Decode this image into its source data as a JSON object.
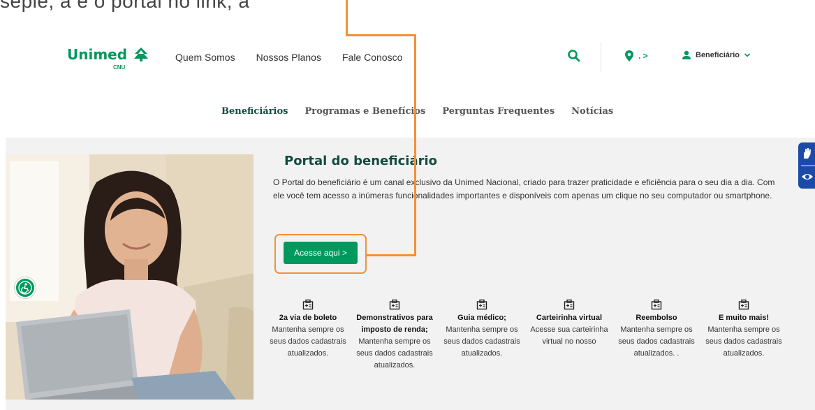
{
  "top_text": "sepie, a e                                            o portal no link, a",
  "logo": {
    "word": "Unimed",
    "sub": "CNU"
  },
  "nav": [
    "Quem Somos",
    "Nossos Planos",
    "Fale Conosco"
  ],
  "location": {
    "label": ". >"
  },
  "user_menu": {
    "label": "Beneficiário"
  },
  "subnav": [
    "Beneficiários",
    "Programas e Benefícios",
    "Perguntas Frequentes",
    "Notícias"
  ],
  "portal": {
    "title": "Portal do beneficiário",
    "description": "O Portal do beneficiário é um canal exclusivo da Unimed Nacional, criado para trazer praticidade e eficiência para o seu dia a dia. Com ele você tem acesso a inúmeras funcionalidades importantes e disponíveis com apenas um clique no seu computador ou smartphone.",
    "cta": "Acesse aqui >"
  },
  "features": [
    {
      "title": "2a via de boleto",
      "desc": "Mantenha sempre os seus dados cadastrais atualizados."
    },
    {
      "title": "Demonstrativos para imposto de renda;",
      "desc": "Mantenha sempre os seus dados cadastrais atualizados."
    },
    {
      "title": "Guia médico;",
      "desc": "Mantenha sempre os seus dados cadastrais atualizados."
    },
    {
      "title": "Carteirinha virtual",
      "desc": "Acesse  sua carteirinha virtual no nosso"
    },
    {
      "title": "Reembolso",
      "desc": "Mantenha sempre os seus dados cadastrais atualizados. ."
    },
    {
      "title": "E muito mais!",
      "desc": "Mantenha sempre os seus dados cadastrais atualizados."
    }
  ],
  "colors": {
    "brand": "#00995d",
    "title": "#124b3f",
    "highlight": "#f0913a",
    "side_tools": "#1c4aa8"
  },
  "icons": [
    "tree-logo-icon",
    "search-icon",
    "location-pin-icon",
    "user-icon",
    "chevron-down-icon",
    "accessibility-icon",
    "sign-language-icon",
    "eye-icon",
    "id-card-icon"
  ]
}
